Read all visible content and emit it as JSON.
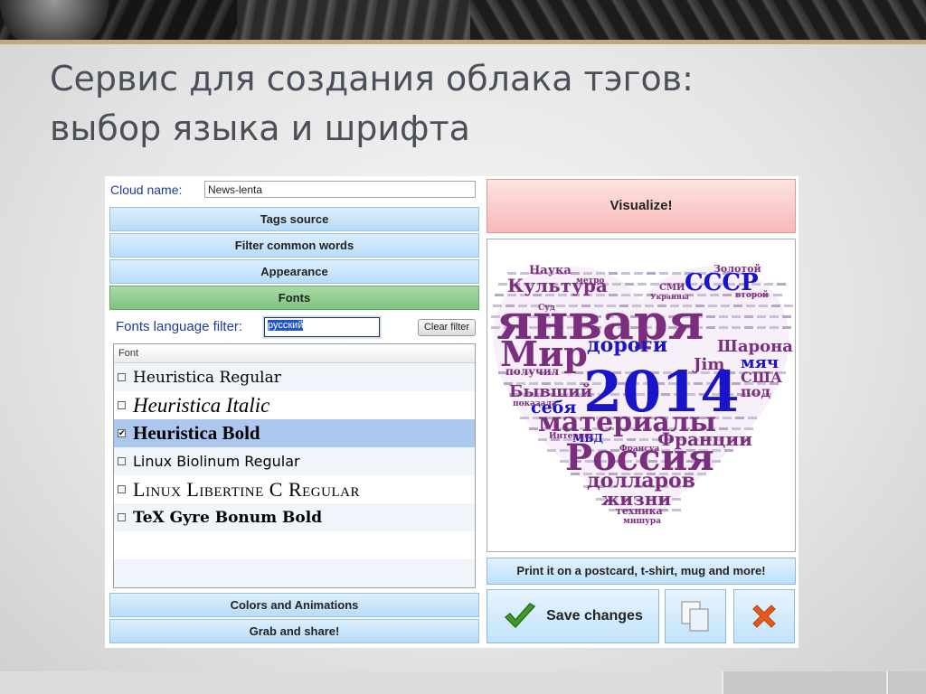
{
  "slide": {
    "title_line1": "Сервис для создания облака тэгов:",
    "title_line2": "выбор языка и шрифта"
  },
  "app": {
    "cloud_name_label": "Cloud name:",
    "cloud_name_value": "News-lenta",
    "sections": {
      "tags_source": "Tags source",
      "filter_common_words": "Filter common words",
      "appearance": "Appearance",
      "fonts": "Fonts",
      "colors_animations": "Colors and Animations",
      "grab_share": "Grab and share!"
    },
    "fonts_panel": {
      "filter_label": "Fonts language filter:",
      "filter_value": "русский",
      "clear_filter": "Clear filter",
      "list_header": "Font",
      "fonts": [
        {
          "name": "Heuristica Regular",
          "checked": false
        },
        {
          "name": "Heuristica Italic",
          "checked": false
        },
        {
          "name": "Heuristica Bold",
          "checked": true
        },
        {
          "name": "Linux Biolinum Regular",
          "checked": false
        },
        {
          "name": "Linux Libertine C Regular",
          "checked": false
        },
        {
          "name": "TeX Gyre Bonum Bold",
          "checked": false
        }
      ]
    },
    "visualize_label": "Visualize!",
    "print_label": "Print it on a postcard, t-shirt, mug and more!",
    "save_label": "Save changes",
    "icons": {
      "save": "checkmark-icon",
      "copy": "copy-icon",
      "close": "close-icon"
    },
    "colors": {
      "accent_green": "#7fc57f",
      "button_blue": "#c3e3fb",
      "visualize_red": "#f7b8b8",
      "word_purple": "#7b2d7e",
      "word_blue": "#1a14c8"
    },
    "word_cloud": {
      "words": [
        "января",
        "2014",
        "Мир",
        "Россия",
        "материалы",
        "Культура",
        "дороги",
        "СССР",
        "Шарона",
        "долларов",
        "жизни",
        "Франции",
        "Бывший",
        "себя",
        "Наука",
        "Золотой",
        "мяч",
        "США",
        "под",
        "Jim",
        "получил",
        "МВД",
        "техника",
        "мишура",
        "метро",
        "СМИ",
        "Суд",
        "показала",
        "Интернет",
        "Франсуа",
        "второй",
        "Украины"
      ]
    }
  }
}
